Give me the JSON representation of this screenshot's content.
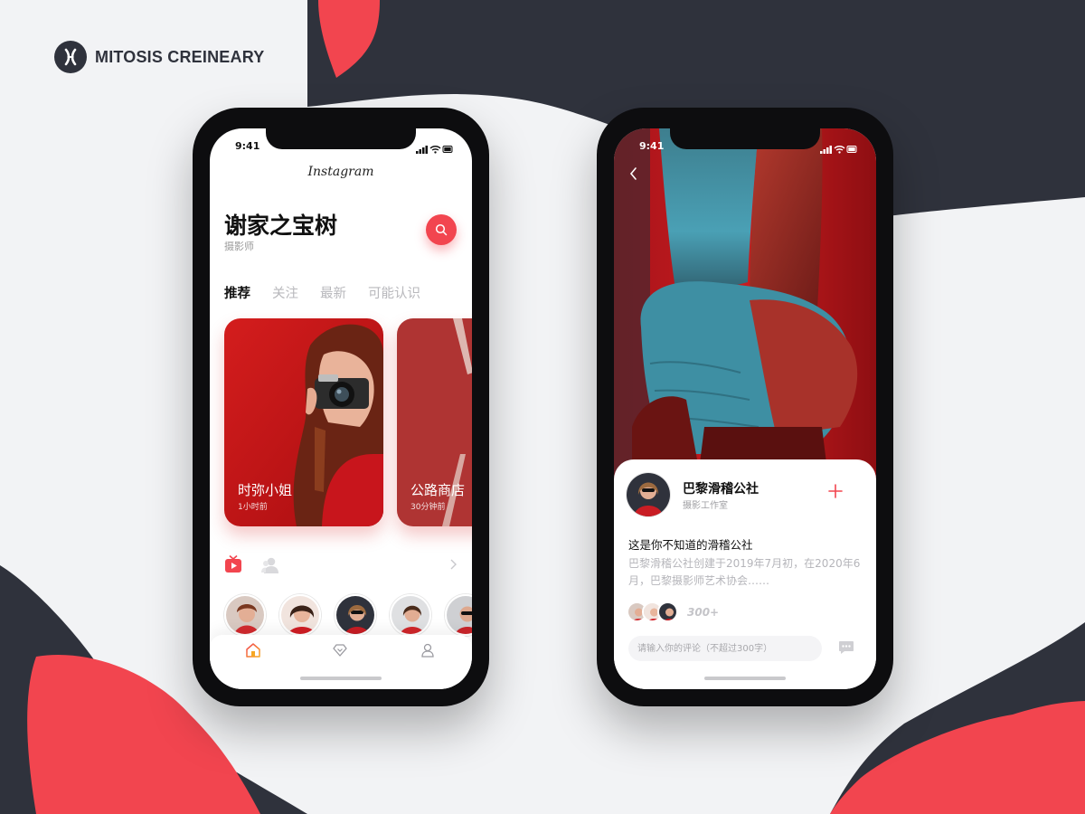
{
  "brand": {
    "name": "MITOSIS CREINEARY"
  },
  "colors": {
    "accent": "#f2454f",
    "dark": "#2f323c"
  },
  "left_phone": {
    "status_time": "9:41",
    "app_name": "Instagram",
    "profile": {
      "name": "谢家之宝树",
      "role": "摄影师"
    },
    "search_icon": "search-icon",
    "tabs": [
      {
        "label": "推荐",
        "active": true
      },
      {
        "label": "关注",
        "active": false
      },
      {
        "label": "最新",
        "active": false
      },
      {
        "label": "可能认识",
        "active": false
      }
    ],
    "cards": [
      {
        "title": "时弥小姐",
        "time": "1小时前"
      },
      {
        "title": "公路商店",
        "time": "30分钟前"
      }
    ],
    "section_icons": [
      "video-icon",
      "people-icon",
      "chevron-right-icon"
    ],
    "avatars_count_visible": 5,
    "tabbar": [
      "home-icon",
      "diamond-icon",
      "profile-icon"
    ]
  },
  "right_phone": {
    "status_time": "9:41",
    "studio": {
      "name": "巴黎滑稽公社",
      "type": "摄影工作室"
    },
    "post": {
      "title": "这是你不知道的滑稽公社",
      "body": "巴黎滑稽公社创建于2019年7月初，在2020年6月，巴黎摄影师艺术协会……"
    },
    "likers_count": "300+",
    "comment_placeholder": "请输入你的评论（不超过300字）"
  }
}
